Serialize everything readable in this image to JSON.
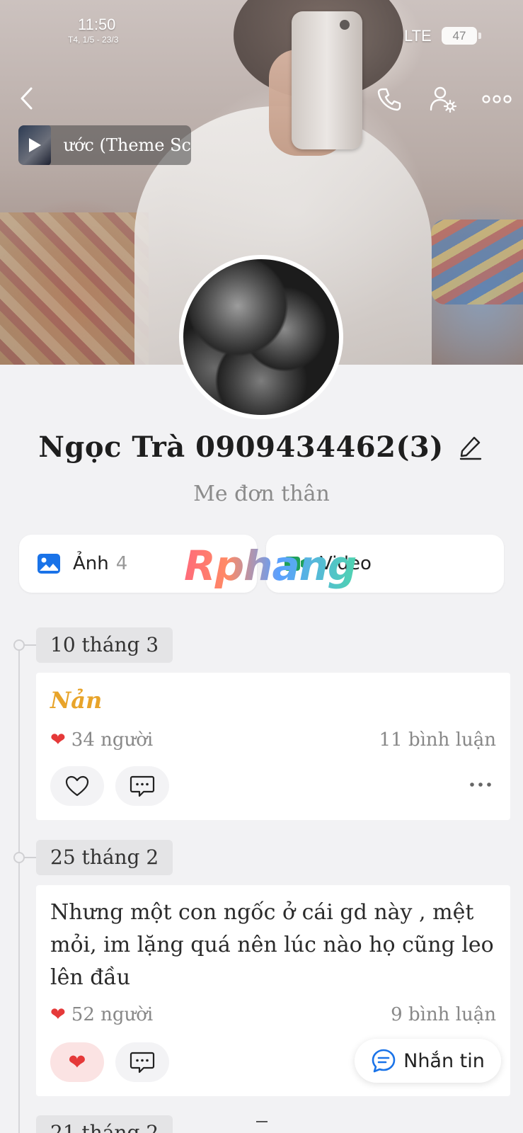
{
  "status_bar": {
    "time": "11:50",
    "date": "T4, 1/5 - 23/3",
    "network": "LTE",
    "battery": "47"
  },
  "header": {
    "music_title": "ước (Theme Sc"
  },
  "profile": {
    "name": "Ngọc Trà 0909434462(3)",
    "bio": "Me đơn thân"
  },
  "media": {
    "photos_label": "Ảnh",
    "photos_count": "4",
    "videos_label": "Video",
    "watermark": "Rphang"
  },
  "timeline": [
    {
      "date": "10 tháng 3",
      "text": "Nản",
      "likes": "34 người",
      "comments": "11 bình luận",
      "liked": false
    },
    {
      "date": "25 tháng 2",
      "text": "Nhưng một con ngốc ở cái gd này , mệt mỏi, im lặng quá nên lúc nào họ cũng leo lên đầu",
      "likes": "52 người",
      "comments": "9 bình luận",
      "liked": true
    },
    {
      "date": "21 tháng 2"
    }
  ],
  "message_button": {
    "label": "Nhắn tin"
  },
  "colors": {
    "accent_blue": "#1a73e8",
    "like_red": "#e53939",
    "status_orange": "#e8a42a"
  },
  "icons": [
    "back-icon",
    "phone-icon",
    "user-settings-icon",
    "more-icon",
    "play-icon",
    "image-icon",
    "video-icon",
    "edit-icon",
    "heart-icon",
    "comment-icon",
    "chat-icon"
  ]
}
